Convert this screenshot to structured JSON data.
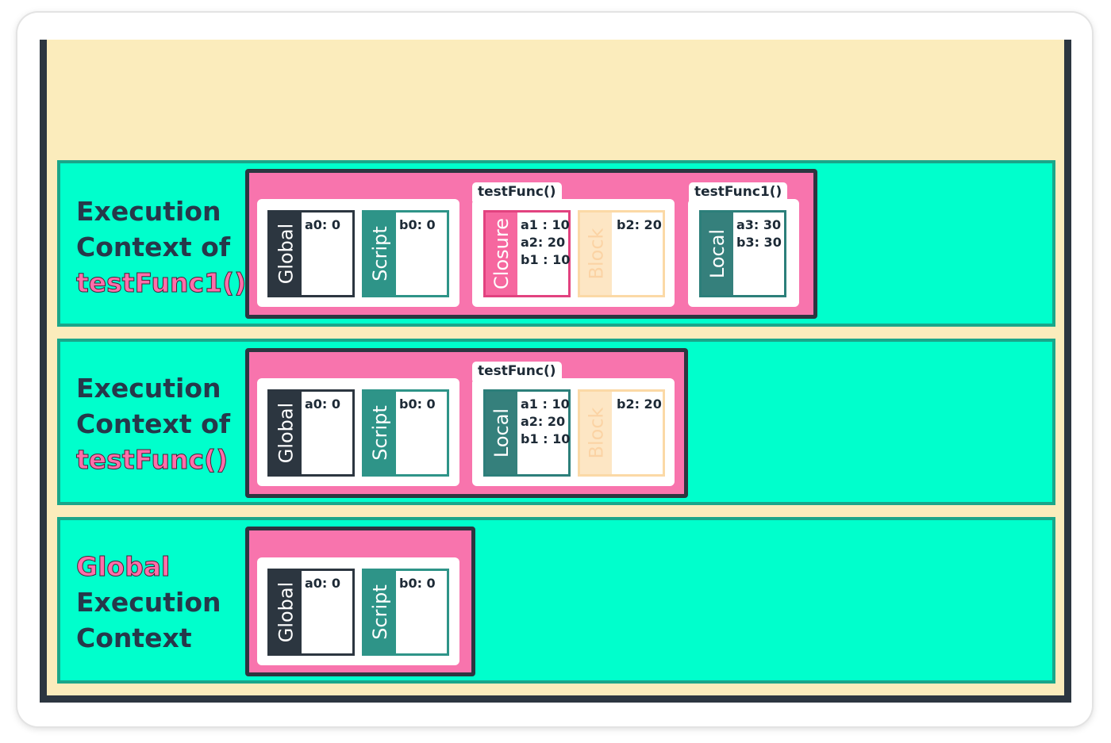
{
  "rows": [
    {
      "label_lines": [
        "Execution",
        "Context of"
      ],
      "highlight": "testFunc1()",
      "scopes": {
        "global": {
          "label": "Global",
          "values": "a0: 0"
        },
        "script": {
          "label": "Script",
          "values": "b0: 0"
        },
        "group1_title": "testFunc()",
        "closure": {
          "label": "Closure",
          "values": "a1 : 10\na2: 20\nb1 : 10"
        },
        "block": {
          "label": "Block",
          "values": "b2: 20"
        },
        "group2_title": "testFunc1()",
        "local": {
          "label": "Local",
          "values": "a3: 30\nb3: 30"
        }
      }
    },
    {
      "label_lines": [
        "Execution",
        "Context of"
      ],
      "highlight": "testFunc()",
      "scopes": {
        "global": {
          "label": "Global",
          "values": "a0: 0"
        },
        "script": {
          "label": "Script",
          "values": "b0: 0"
        },
        "group1_title": "testFunc()",
        "local": {
          "label": "Local",
          "values": "a1 : 10\na2: 20\nb1 : 10"
        },
        "block": {
          "label": "Block",
          "values": "b2: 20"
        }
      }
    },
    {
      "highlight": "Global",
      "label_lines": [
        "Execution",
        "Context"
      ],
      "scopes": {
        "global": {
          "label": "Global",
          "values": "a0: 0"
        },
        "script": {
          "label": "Script",
          "values": "b0: 0"
        }
      }
    }
  ],
  "colors": {
    "stack_background": "#fbecbc",
    "row_background": "#00ffcc",
    "scope_container": "#f874ad",
    "global_scope": "#2c3640",
    "script_scope": "#2e9488",
    "local_scope": "#35807c",
    "closure_scope": "#f6679f",
    "block_scope": "#fde6c4",
    "highlight_text": "#ff6eaa"
  }
}
